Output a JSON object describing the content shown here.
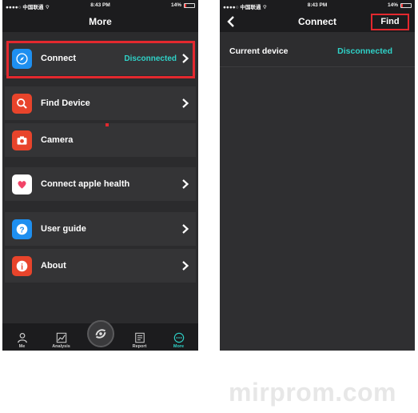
{
  "left_screen": {
    "status": {
      "carrier": "●●●●○ 中国联通 ⌔",
      "time": "8:43 PM",
      "battery_pct": "14%"
    },
    "title": "More",
    "menu": [
      {
        "label": "Connect",
        "status": "Disconnected",
        "icon": "compass-icon",
        "color": "#1e8ff0"
      },
      {
        "label": "Find Device",
        "icon": "search-icon",
        "color": "#e8442b"
      },
      {
        "label": "Camera",
        "icon": "camera-icon",
        "color": "#e8442b"
      },
      {
        "label": "Connect apple health",
        "icon": "heart-icon",
        "color": "#ffffff"
      },
      {
        "label": "User guide",
        "icon": "question-icon",
        "color": "#1e8ff0"
      },
      {
        "label": "About",
        "icon": "info-icon",
        "color": "#e8442b"
      }
    ],
    "tabs": [
      {
        "label": "Me",
        "icon": "person-icon"
      },
      {
        "label": "Analysis",
        "icon": "chart-icon"
      },
      {
        "label": "",
        "icon": "sync-icon"
      },
      {
        "label": "Report",
        "icon": "report-icon"
      },
      {
        "label": "More",
        "icon": "more-icon",
        "active": true
      }
    ]
  },
  "right_screen": {
    "status": {
      "carrier": "●●●●○ 中国联通 ⌔",
      "time": "8:43 PM",
      "battery_pct": "14%"
    },
    "title": "Connect",
    "find_label": "Find",
    "current_device_label": "Current device",
    "current_device_status": "Disconnected"
  },
  "watermark": "mirprom.com",
  "colors": {
    "accent": "#2fd2c8",
    "highlight": "#e3282e",
    "background": "#2b2b2d"
  }
}
